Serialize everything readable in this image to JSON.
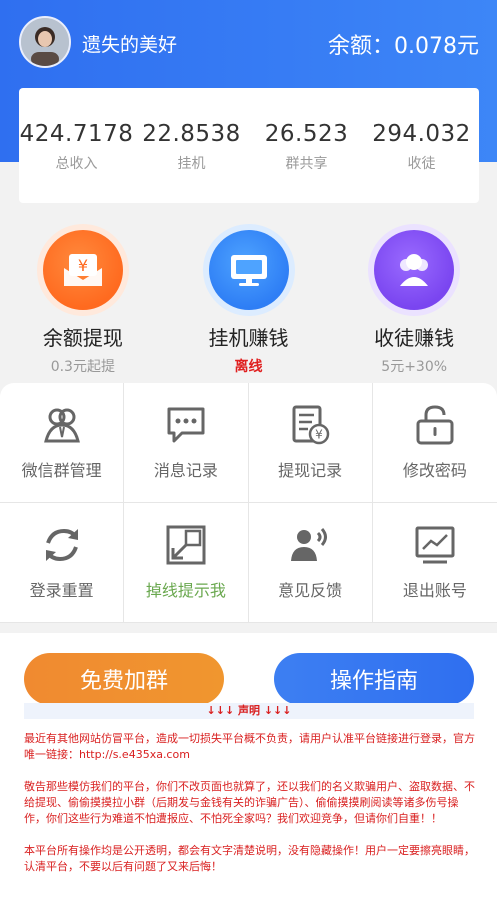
{
  "header": {
    "username": "遗失的美好",
    "balance": "余额：0.078元"
  },
  "stats": [
    {
      "value": "424.7178",
      "label": "总收入"
    },
    {
      "value": "22.8538",
      "label": "挂机"
    },
    {
      "value": "26.523",
      "label": "群共享"
    },
    {
      "value": "294.032",
      "label": "收徒"
    }
  ],
  "actions": [
    {
      "title": "余额提现",
      "subtitle": "0.3元起提",
      "icon": "withdraw-icon",
      "color": "#ff6a1f"
    },
    {
      "title": "挂机赚钱",
      "subtitle": "离线",
      "icon": "monitor-icon",
      "color": "#2e7ef5"
    },
    {
      "title": "收徒赚钱",
      "subtitle": "5元+30%",
      "icon": "users-icon",
      "color": "#7a45f0"
    }
  ],
  "menu": [
    {
      "label": "微信群管理",
      "icon": "group-icon"
    },
    {
      "label": "消息记录",
      "icon": "message-icon"
    },
    {
      "label": "提现记录",
      "icon": "withdraw-record-icon"
    },
    {
      "label": "修改密码",
      "icon": "lock-icon"
    },
    {
      "label": "登录重置",
      "icon": "refresh-icon"
    },
    {
      "label": "掉线提示我",
      "icon": "alert-link-icon"
    },
    {
      "label": "意见反馈",
      "icon": "feedback-icon"
    },
    {
      "label": "退出账号",
      "icon": "logout-icon"
    }
  ],
  "buttons": {
    "join_group": "免费加群",
    "guide": "操作指南"
  },
  "notice": {
    "title": "↓↓↓ 声明 ↓↓↓",
    "p1": "最近有其他网站仿冒平台，造成一切损失平台概不负责，请用户认准平台链接进行登录，官方唯一链接：http://s.e435xa.com",
    "p2": "敬告那些模仿我们的平台，你们不改页面也就算了，还以我们的名义欺骗用户、盗取数据、不给提现、偷偷摸摸拉小群（后期发与金钱有关的诈骗广告）、偷偷摸摸刷阅读等诸多伤号操作，你们这些行为难道不怕遭报应、不怕死全家吗？我们欢迎竞争，但请你们自重！！",
    "p3": "本平台所有操作均是公开透明，都会有文字清楚说明，没有隐藏操作！用户一定要擦亮眼睛，认清平台，不要以后有问题了又来后悔！"
  }
}
